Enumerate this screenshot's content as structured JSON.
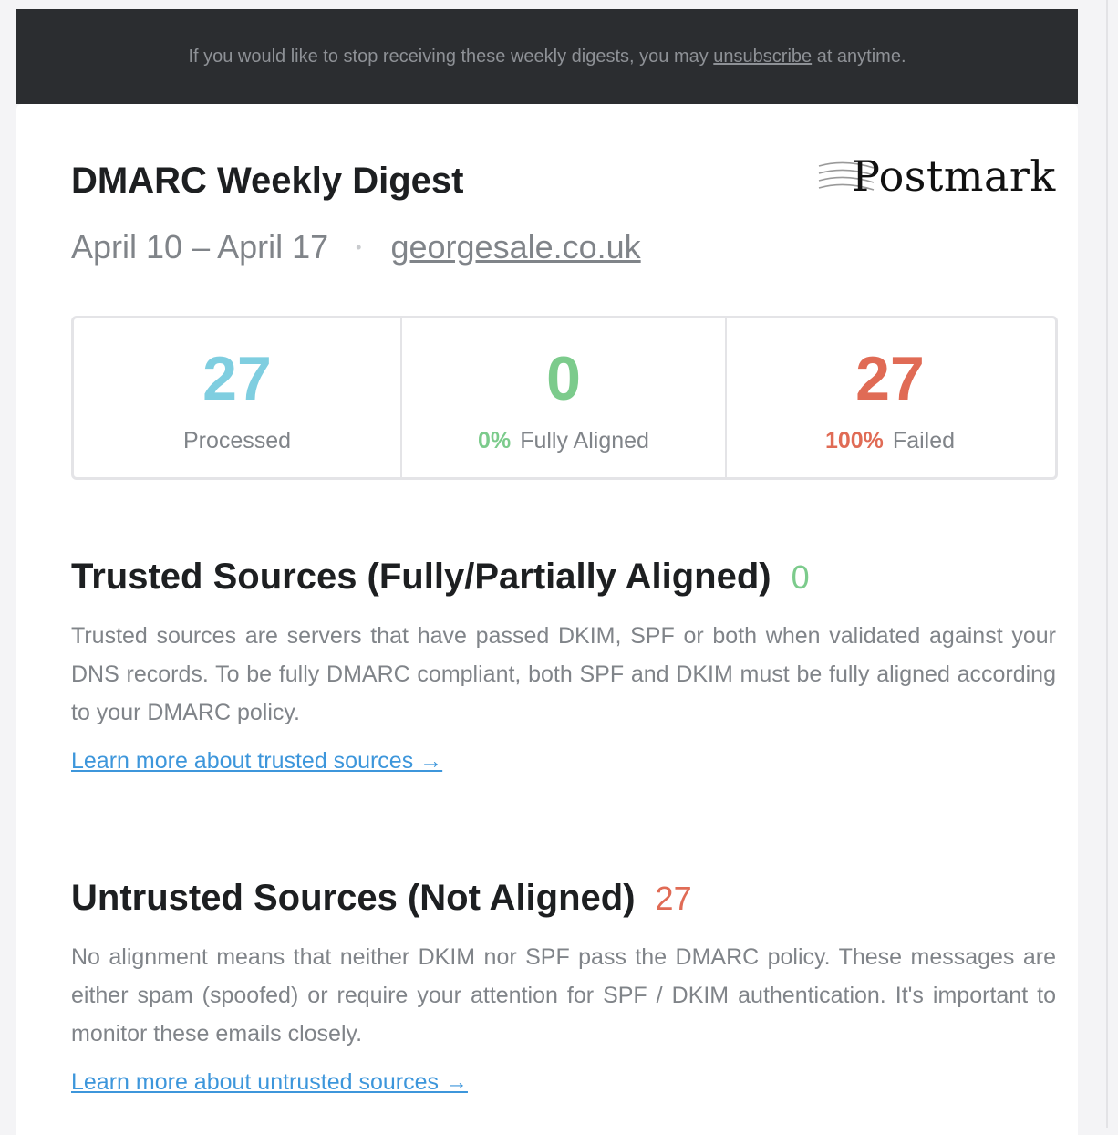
{
  "colors": {
    "processed": "#7fcee0",
    "aligned": "#7ccb8c",
    "failed": "#e06b55",
    "link": "#3d96db"
  },
  "banner": {
    "text_before": "If you would like to stop receiving these weekly digests, you may ",
    "link_label": "unsubscribe",
    "text_after": " at anytime."
  },
  "header": {
    "title": "DMARC Weekly Digest",
    "logo_text": "Postmark",
    "date_range": "April 10 – April 17",
    "separator": "•",
    "domain": "georgesale.co.uk"
  },
  "stats": [
    {
      "value": "27",
      "percent": "",
      "label": "Processed"
    },
    {
      "value": "0",
      "percent": "0%",
      "label": "Fully Aligned"
    },
    {
      "value": "27",
      "percent": "100%",
      "label": "Failed"
    }
  ],
  "sections": {
    "trusted": {
      "heading": "Trusted Sources (Fully/Partially Aligned)",
      "count": "0",
      "description": "Trusted sources are servers that have passed DKIM, SPF or both when validated against your DNS records. To be fully DMARC compliant, both SPF and DKIM must be fully aligned according to your DMARC policy.",
      "link_label": "Learn more about trusted sources →"
    },
    "untrusted": {
      "heading": "Untrusted Sources (Not Aligned)",
      "count": "27",
      "description": "No alignment means that neither DKIM nor SPF pass the DMARC policy. These messages are either spam (spoofed) or require your attention for SPF / DKIM authentication. It's important to monitor these emails closely.",
      "link_label": "Learn more about untrusted sources →"
    }
  }
}
